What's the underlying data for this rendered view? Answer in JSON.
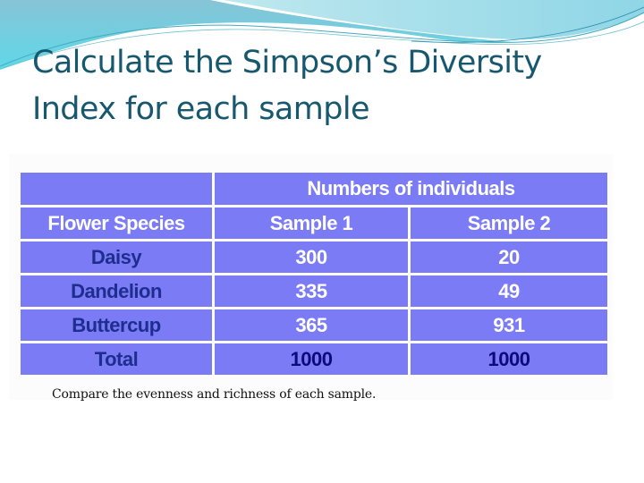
{
  "slide": {
    "title": "Calculate the Simpson’s Diversity Index for each sample",
    "colors": {
      "title": "#17586e",
      "table_cell": "#7b7bf5",
      "header_text": "#ffffff",
      "species_text": "#1d2e8f",
      "total_text": "#0b0b7a"
    }
  },
  "table": {
    "group_header": "Numbers of individuals",
    "column_headers": [
      "Flower Species",
      "Sample 1",
      "Sample 2"
    ],
    "rows": [
      {
        "species": "Daisy",
        "sample1": "300",
        "sample2": "20"
      },
      {
        "species": "Dandelion",
        "sample1": "335",
        "sample2": "49"
      },
      {
        "species": "Buttercup",
        "sample1": "365",
        "sample2": "931"
      }
    ],
    "total": {
      "label": "Total",
      "sample1": "1000",
      "sample2": "1000"
    }
  },
  "caption": "Compare the evenness and richness of each sample."
}
